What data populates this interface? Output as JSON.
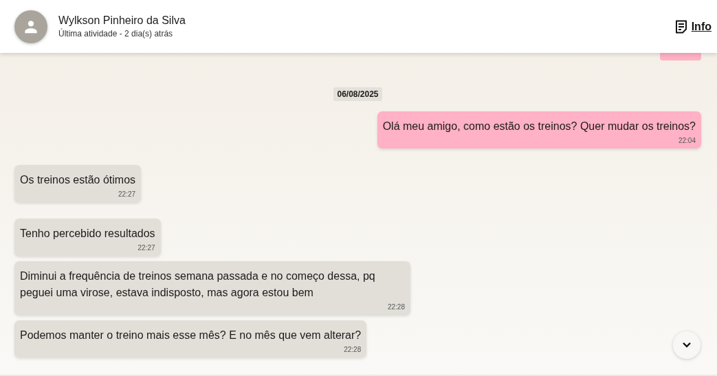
{
  "contact": {
    "name": "Wylkson Pinheiro da Silva",
    "status": "Última atividade - 2 dia(s) atrás"
  },
  "info_link": {
    "label": "Info"
  },
  "date_separator": "06/08/2025",
  "messages": [
    {
      "kind": "out",
      "text": "Olá meu amigo, como estão os treinos? Quer mudar os treinos?",
      "time": "22:04"
    },
    {
      "kind": "in",
      "text": "Os treinos estão ótimos",
      "time": "22:27"
    },
    {
      "kind": "in",
      "text": "Tenho percebido resultados",
      "time": "22:27"
    },
    {
      "kind": "in",
      "text": "Diminui a frequência de treinos semana passada e no começo dessa, pq peguei uma virose, estava indisposto, mas agora estou bem",
      "time": "22:28"
    },
    {
      "kind": "in",
      "text": "Podemos manter o treino mais esse mês? E no mês que vem alterar?",
      "time": "22:28"
    }
  ]
}
